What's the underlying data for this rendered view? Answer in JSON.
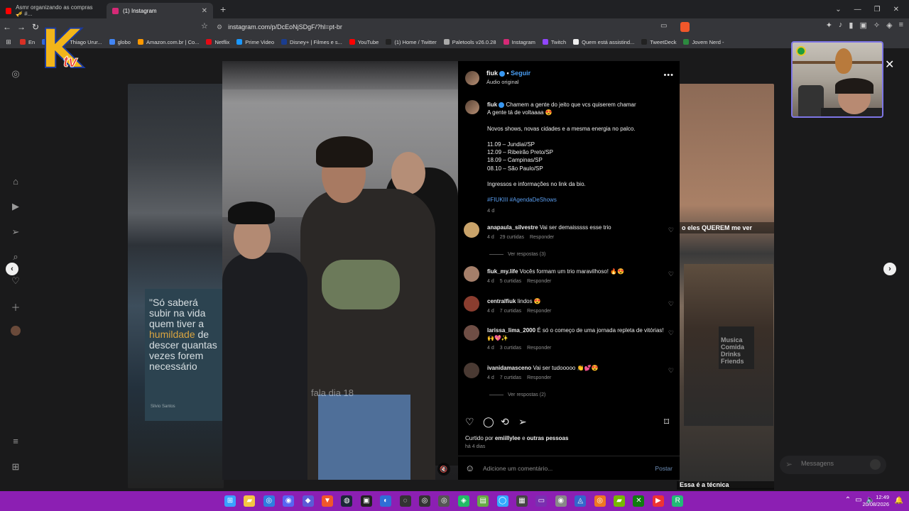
{
  "browser": {
    "tabs": [
      {
        "label": "Asmr organizando as compras 🎺 #..."
      },
      {
        "label": "(1) Instagram"
      }
    ],
    "url": "instagram.com/p/DcEoNjSDgF/?hl=pt-br",
    "bookmarks": [
      {
        "label": "En",
        "color": "#d93025"
      },
      {
        "label": "Email – Thiago Urur...",
        "color": "#3367d6"
      },
      {
        "label": "globo",
        "color": "#4285f4"
      },
      {
        "label": "Amazon.com.br | Co...",
        "color": "#ff9900"
      },
      {
        "label": "Netflix",
        "color": "#e50914"
      },
      {
        "label": "Prime Video",
        "color": "#1a98ff"
      },
      {
        "label": "Disney+ | Filmes e s...",
        "color": "#1a3d8f"
      },
      {
        "label": "YouTube",
        "color": "#ff0000"
      },
      {
        "label": "(1) Home / Twitter",
        "color": "#222222"
      },
      {
        "label": "Paletools v26.0.28",
        "color": "#aaaaaa"
      },
      {
        "label": "Instagram",
        "color": "#d62976"
      },
      {
        "label": "Twitch",
        "color": "#9146ff"
      },
      {
        "label": "Quem está assistind...",
        "color": "#eeeeee"
      },
      {
        "label": "TweetDeck",
        "color": "#222222"
      },
      {
        "label": "Jovem Nerd -",
        "color": "#2c8a3f"
      }
    ]
  },
  "post": {
    "username": "fiuk",
    "follow_label": "Seguir",
    "audio_label": "Áudio original",
    "caption_lines": [
      "Chamem a gente do jeito que vcs quiserem chamar",
      "A gente tá de voltaaaa 😍",
      "",
      "Novos shows, novas cidades e a mesma energia no palco.",
      "",
      "11.09 – Jundiaí/SP",
      "12.09 – Ribeirão Preto/SP",
      "18.09 – Campinas/SP",
      "08.10 – São Paulo/SP",
      "",
      "Ingressos e informações no link da bio."
    ],
    "hashtags": "#FIUKIII #AgendaDeShows",
    "caption_time": "4 d",
    "comments": [
      {
        "user": "anapaula_silvestre",
        "text": "Vai ser demaisssss esse trio",
        "time": "4 d",
        "likes": "29 curtidas",
        "reply": "Responder",
        "replies_label": "Ver respostas (3)"
      },
      {
        "user": "fiuk_my.life",
        "text": "Vocês formam um trio maravilhoso! 🔥😍",
        "time": "4 d",
        "likes": "5 curtidas",
        "reply": "Responder",
        "replies_label": ""
      },
      {
        "user": "centralfiuk",
        "text": "lindos 😍",
        "time": "4 d",
        "likes": "7 curtidas",
        "reply": "Responder",
        "replies_label": ""
      },
      {
        "user": "larissa_lima_2000",
        "text": "É só o começo de uma jornada repleta de vitórias! 🙌💖✨",
        "time": "4 d",
        "likes": "3 curtidas",
        "reply": "Responder",
        "replies_label": ""
      },
      {
        "user": "ivanidamasceno",
        "text": "Vai ser tudooooo 👏💕😍",
        "time": "4 d",
        "likes": "7 curtidas",
        "reply": "Responder",
        "replies_label": "Ver respostas (2)"
      }
    ],
    "liked_prefix": "Curtido por",
    "liked_user": "emiillylee",
    "liked_and": "e",
    "liked_others": "outras pessoas",
    "posted_ago": "há 4 dias",
    "comment_placeholder": "Adicione um comentário...",
    "post_button": "Postar"
  },
  "video": {
    "overlay_text": "fala dia 18"
  },
  "background": {
    "quote_pre": "\"Só saberá subir na vida quem tiver a ",
    "quote_hl": "humildade",
    "quote_post": " de descer quantas vezes forem necessário",
    "quote_source": "Silvio Santos",
    "right_tag": "o eles QUEREM me ver",
    "bottom_tag": "Essa é a técnica",
    "shirt_text": "Musica Comida Drinks Friends"
  },
  "messages_label": "Messagens",
  "overlay_logo": {
    "big": "K",
    "small": "tv"
  },
  "clock": {
    "time": "12:49",
    "date": "20/08/2026"
  }
}
